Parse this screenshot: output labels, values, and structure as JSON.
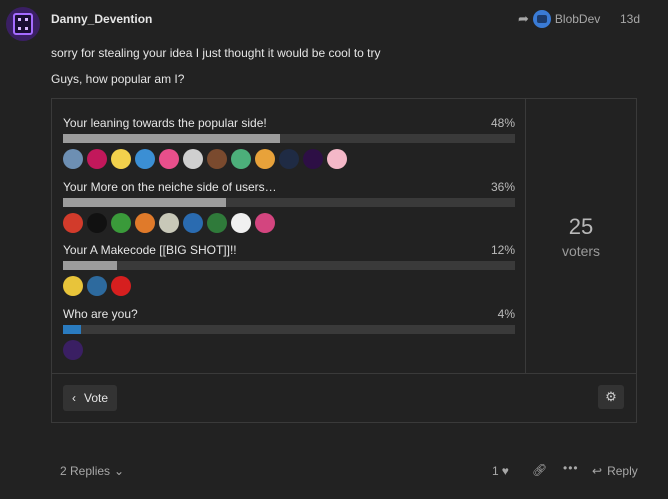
{
  "post": {
    "username": "Danny_Devention",
    "reply_to": "BlobDev",
    "date": "13d",
    "paragraphs": [
      "sorry for stealing your idea I just thought it would be cool to try",
      "Guys, how popular am I?"
    ]
  },
  "poll": {
    "options": [
      {
        "label": "Your leaning towards the popular side!",
        "percent_text": "48%",
        "percent": 48,
        "mine": false,
        "voter_colors": [
          "#6d8fb3",
          "#c2185b",
          "#f2d14c",
          "#3b8fd4",
          "#e84f8b",
          "#cfcfcf",
          "#7a4a2e",
          "#4caf7a",
          "#e8a23a",
          "#1f2b44",
          "#2d0f45",
          "#f4b8c8"
        ]
      },
      {
        "label": "Your More on the neiche side of users…",
        "percent_text": "36%",
        "percent": 36,
        "mine": false,
        "voter_colors": [
          "#d23b2b",
          "#111111",
          "#3a9a3a",
          "#e07a2a",
          "#c8c8b8",
          "#2a6bb0",
          "#2f7a3a",
          "#f0f0f0",
          "#d3457f"
        ]
      },
      {
        "label": "Your A Makecode [[BIG SHOT]]!!",
        "percent_text": "12%",
        "percent": 12,
        "mine": false,
        "voter_colors": [
          "#e8c43a",
          "#2d6a9e",
          "#d61f1f"
        ]
      },
      {
        "label": "Who are you?",
        "percent_text": "4%",
        "percent": 4,
        "mine": true,
        "voter_colors": [
          "#3a1f63"
        ]
      }
    ],
    "voters_count": "25",
    "voters_label": "voters",
    "vote_label": "Vote"
  },
  "footer": {
    "replies_label": "2 Replies",
    "like_count": "1",
    "reply_label": "Reply"
  },
  "icons": {
    "reply_arrow": "reply-arrow-icon",
    "chevron_left": "chevron-left-icon",
    "gear": "gear-icon",
    "chevron_down": "chevron-down-icon",
    "heart": "heart-icon",
    "link": "link-icon",
    "more": "more-icon",
    "reply": "reply-icon"
  }
}
